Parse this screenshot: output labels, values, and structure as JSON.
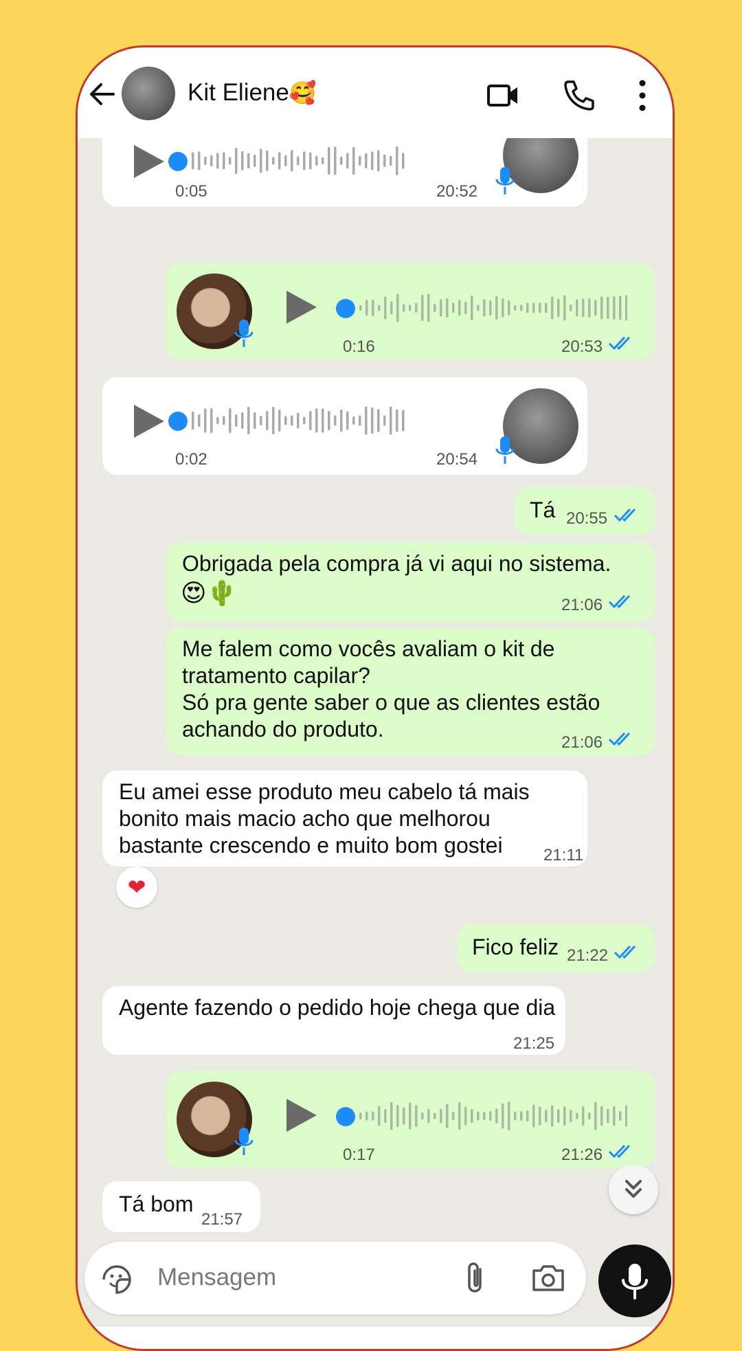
{
  "header": {
    "contact_name": "Kit Eliene",
    "contact_emoji": "🥰"
  },
  "messages": [
    {
      "dir": "in",
      "type": "voice",
      "duration": "0:05",
      "time": "20:52"
    },
    {
      "dir": "out",
      "type": "voice",
      "duration": "0:16",
      "time": "20:53"
    },
    {
      "dir": "in",
      "type": "voice",
      "duration": "0:02",
      "time": "20:54"
    },
    {
      "dir": "out",
      "type": "text",
      "text": "Tá",
      "time": "20:55"
    },
    {
      "dir": "out",
      "type": "text",
      "text": "Obrigada pela compra já vi aqui no sistema.",
      "emoji": "😍🌵",
      "time": "21:06"
    },
    {
      "dir": "out",
      "type": "text",
      "lines": [
        "Me falem como vocês avaliam o kit de",
        "tratamento capilar?",
        "Só pra gente saber o que as clientes estão",
        "achando do produto."
      ],
      "time": "21:06"
    },
    {
      "dir": "in",
      "type": "text",
      "lines": [
        "Eu amei esse produto meu cabelo tá mais",
        "bonito mais macio acho que melhorou",
        "bastante crescendo e muito bom gostei"
      ],
      "time": "21:11",
      "reaction": "❤"
    },
    {
      "dir": "out",
      "type": "text",
      "text": "Fico feliz",
      "time": "21:22"
    },
    {
      "dir": "in",
      "type": "text",
      "text": "Agente fazendo o pedido hoje chega que dia",
      "time": "21:25"
    },
    {
      "dir": "out",
      "type": "voice",
      "duration": "0:17",
      "time": "21:26"
    },
    {
      "dir": "in",
      "type": "text",
      "text": "Tá bom",
      "time": "21:57"
    }
  ],
  "input": {
    "placeholder": "Mensagem"
  },
  "icons": [
    "back-arrow-icon",
    "video-call-icon",
    "phone-icon",
    "more-vert-icon",
    "play-icon",
    "mic-icon",
    "double-check-icon",
    "sticker-icon",
    "paperclip-icon",
    "camera-icon",
    "chevron-double-down-icon"
  ],
  "colors": {
    "outgoing": "#dcfcc9",
    "incoming": "#ffffff",
    "tick": "#1d8cf8",
    "background": "#fdd55a",
    "frame": "#c0392b"
  }
}
